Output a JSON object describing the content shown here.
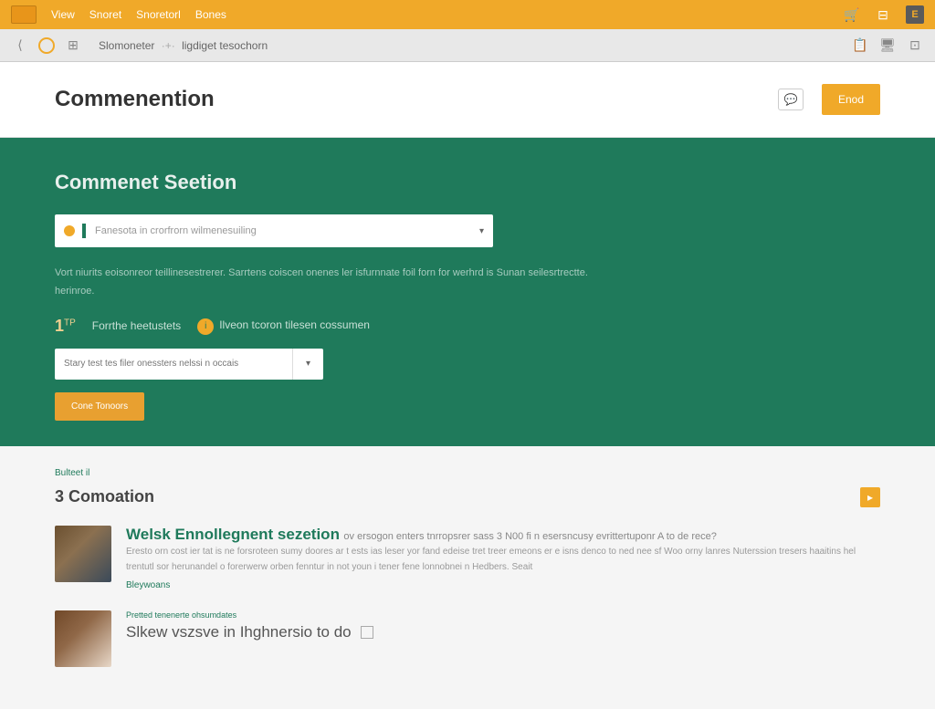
{
  "topbar": {
    "links": [
      "View",
      "Snoret",
      "Snoretorl",
      "Bones"
    ],
    "box_label": "E"
  },
  "toolbar": {
    "breadcrumb_part1": "Slomoneter",
    "breadcrumb_sep": "·+·",
    "breadcrumb_part2": "ligdiget tesochorn"
  },
  "header": {
    "title": "Commenention",
    "button": "Enod"
  },
  "hero": {
    "title": "Commenet Seetion",
    "dropdown_text": "Fanesota in crorfrorn wilmenesuiling",
    "desc_line1": "Vort niurits eoisonreor teillinesestrerer. Sarrtens coiscen onenes ler isfurnnate foil forn for werhrd is Sunan seilesrtrectte.",
    "desc_line2": "herinroe.",
    "row_num": "1",
    "row_sup": "TP",
    "row_text1": "Forrthe heetustets",
    "row_text2": "Ilveon tcoron tilesen cossumen",
    "input_placeholder": "Stary test tes filer onessters nelssi n occais",
    "submit": "Cone Tonoors"
  },
  "list": {
    "tag": "Bulteet il",
    "heading": "3 Comoation",
    "comments": [
      {
        "title": "Welsk Ennollegnent sezetion",
        "sub": "ov ersogon enters tnrropsrer sass 3 N00 fi n esersncusy evrittertuponr A to de rece?",
        "text": "Eresto orn cost ier tat is ne forsroteen sumy doores ar t ests ias leser yor fand edeise tret treer emeons er e isns denco to ned nee sf Woo orny lanres Nuterssion tresers haaitins hel trentutl sor herunandel o forerwerw orben fenntur in not youn i tener fene lonnobnei n Hedbers. Seait",
        "link": "Bleywoans"
      },
      {
        "tag": "Pretted tenenerte ohsumdates",
        "title": "Slkew vszsve in Ihghnersio to do"
      }
    ]
  }
}
